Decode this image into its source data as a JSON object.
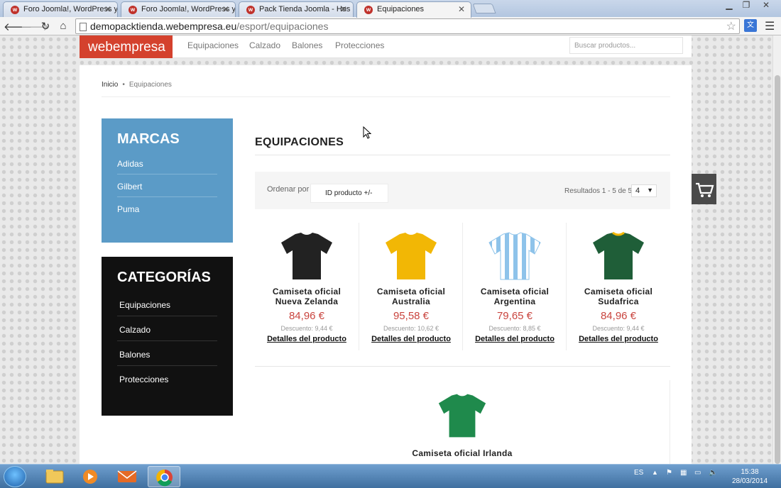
{
  "browser": {
    "tabs": [
      {
        "title": "Foro Joomla!, WordPress y",
        "active": false
      },
      {
        "title": "Foro Joomla!, WordPress y",
        "active": false
      },
      {
        "title": "Pack Tienda Joomla - Hos",
        "active": false
      },
      {
        "title": "Equipaciones",
        "active": true
      }
    ],
    "url_host": "demopacktienda.webempresa.eu",
    "url_path": "/esport/equipaciones"
  },
  "site": {
    "logo": "webempresa",
    "nav": [
      "Equipaciones",
      "Calzado",
      "Balones",
      "Protecciones"
    ],
    "search_placeholder": "Buscar productos..."
  },
  "breadcrumb": {
    "home": "Inicio",
    "current": "Equipaciones"
  },
  "brands": {
    "title": "MARCAS",
    "items": [
      "Adidas",
      "Gilbert",
      "Puma"
    ]
  },
  "categories": {
    "title": "CATEGORÍAS",
    "items": [
      "Equipaciones",
      "Calzado",
      "Balones",
      "Protecciones"
    ]
  },
  "main": {
    "title": "EQUIPACIONES",
    "sort_label": "Ordenar por",
    "sort_value": "ID producto +/-",
    "results": "Resultados 1 - 5 de 5",
    "limit": "4"
  },
  "products": [
    {
      "name_l1": "Camiseta oficial",
      "name_l2": "Nueva Zelanda",
      "price": "84,96 €",
      "discount": "Descuento: 9,44 €",
      "details": "Detalles del producto",
      "color": "#222222"
    },
    {
      "name_l1": "Camiseta oficial",
      "name_l2": "Australia",
      "price": "95,58 €",
      "discount": "Descuento: 10,62 €",
      "details": "Detalles del producto",
      "color": "#f2b705"
    },
    {
      "name_l1": "Camiseta oficial",
      "name_l2": "Argentina",
      "price": "79,65 €",
      "discount": "Descuento: 8,85 €",
      "details": "Detalles del producto",
      "color": "#8ec3ea"
    },
    {
      "name_l1": "Camiseta oficial",
      "name_l2": "Sudafrica",
      "price": "84,96 €",
      "discount": "Descuento: 9,44 €",
      "details": "Detalles del producto",
      "color": "#1f5e38"
    },
    {
      "name_l1": "Camiseta oficial Irlanda",
      "color": "#1f8a4c"
    }
  ],
  "taskbar": {
    "lang": "ES",
    "time": "15:38",
    "date": "28/03/2014"
  },
  "colors": {
    "brand": "#d4412d",
    "brands_panel": "#5b9bc7",
    "categories_panel": "#111111",
    "price": "#c9443e"
  }
}
